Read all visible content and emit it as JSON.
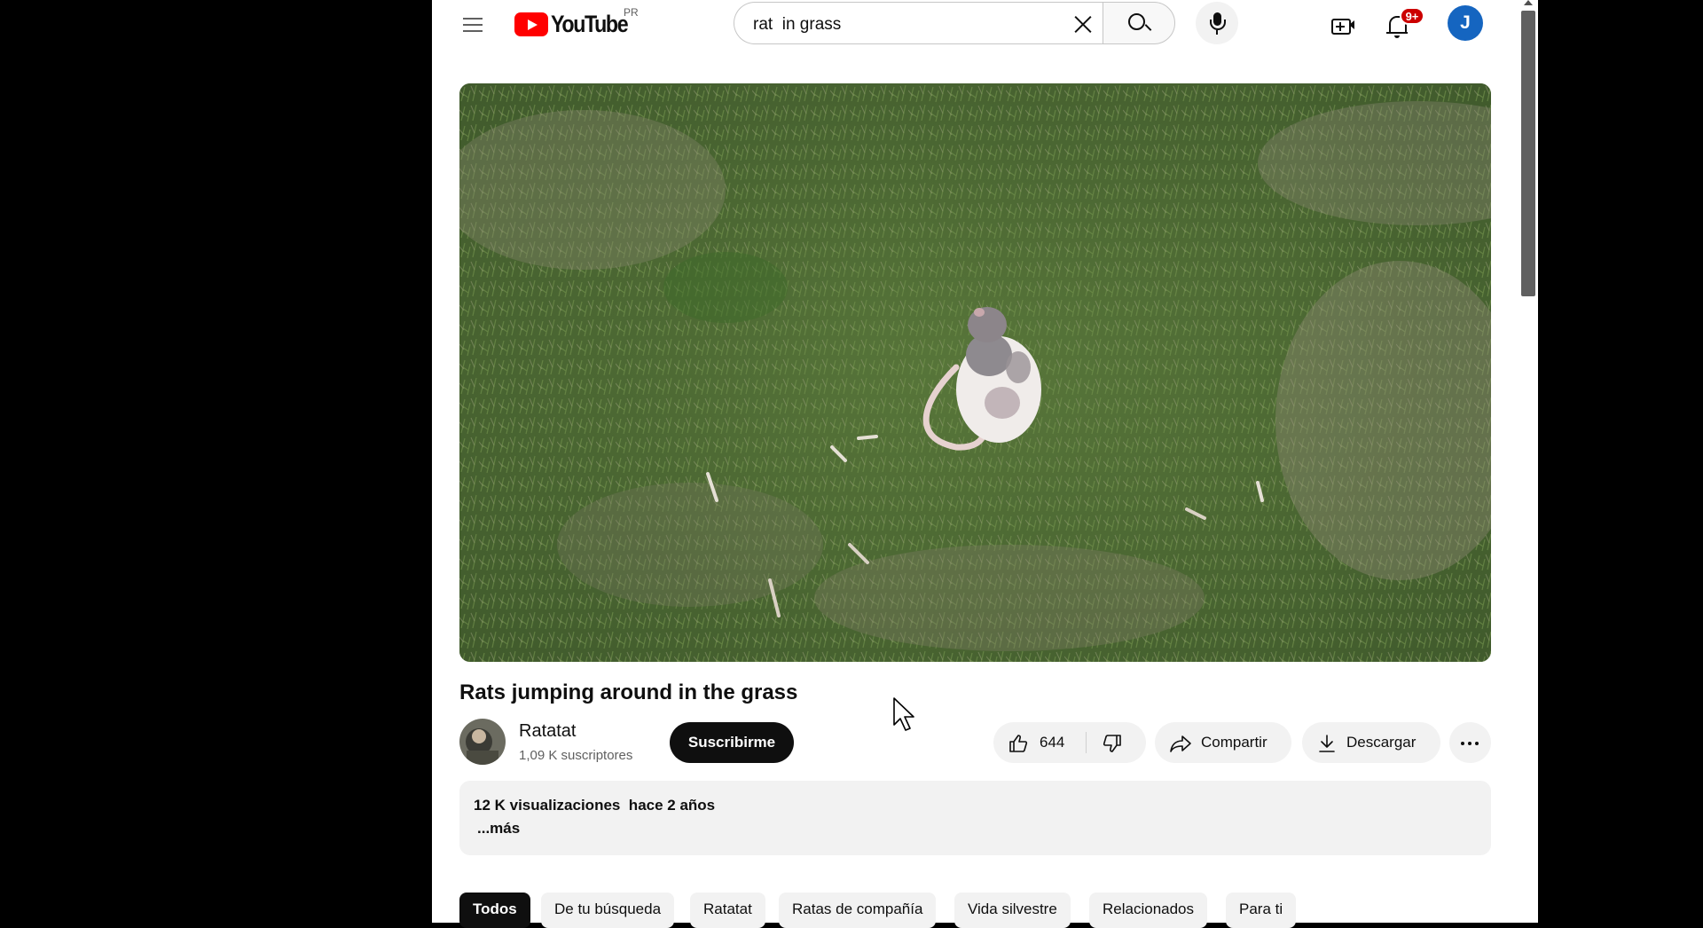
{
  "header": {
    "logo_text": "YouTube",
    "logo_region": "PR",
    "search_value": "rat  in grass",
    "notification_count": "9+",
    "avatar_letter": "J"
  },
  "video": {
    "title": "Rats jumping around in the grass"
  },
  "channel": {
    "name": "Ratatat",
    "subscribers": "1,09 K suscriptores",
    "subscribe_label": "Suscribirme"
  },
  "actions": {
    "like_count": "644",
    "share_label": "Compartir",
    "download_label": "Descargar"
  },
  "description": {
    "meta": "12 K visualizaciones  hace 2 años",
    "more": "...más"
  },
  "chips": [
    {
      "label": "Todos",
      "active": true
    },
    {
      "label": "De tu búsqueda"
    },
    {
      "label": "Ratatat"
    },
    {
      "label": "Ratas de compañía"
    },
    {
      "label": "Vida silvestre"
    },
    {
      "label": "Relacionados"
    },
    {
      "label": "Para ti"
    }
  ],
  "colors": {
    "brand_red": "#ff0000",
    "text_primary": "#0f0f0f",
    "text_secondary": "#606060",
    "chip_bg": "#f2f2f2",
    "badge_red": "#cc0000",
    "avatar_blue": "#1565c0"
  }
}
